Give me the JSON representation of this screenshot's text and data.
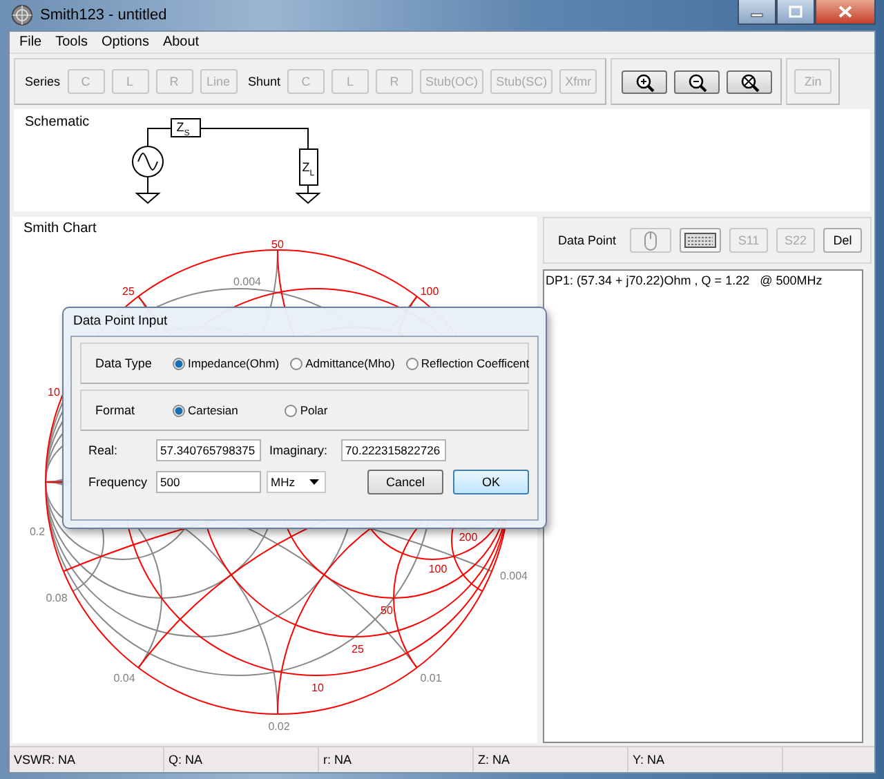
{
  "window": {
    "title": "Smith123 - untitled"
  },
  "menu": [
    "File",
    "Tools",
    "Options",
    "About"
  ],
  "toolbar": {
    "series_label": "Series",
    "series_buttons": [
      {
        "label": "C",
        "disabled": true
      },
      {
        "label": "L",
        "disabled": true
      },
      {
        "label": "R",
        "disabled": true
      },
      {
        "label": "Line",
        "disabled": true
      }
    ],
    "shunt_label": "Shunt",
    "shunt_buttons": [
      {
        "label": "C",
        "disabled": true
      },
      {
        "label": "L",
        "disabled": true
      },
      {
        "label": "R",
        "disabled": true
      },
      {
        "label": "Stub(OC)",
        "disabled": true
      },
      {
        "label": "Stub(SC)",
        "disabled": true
      },
      {
        "label": "Xfmr",
        "disabled": true
      }
    ],
    "zoom_buttons": [
      {
        "kind": "zoom-in",
        "disabled": false
      },
      {
        "kind": "zoom-out",
        "disabled": false
      },
      {
        "kind": "zoom-fit",
        "disabled": false
      }
    ],
    "zin_button": {
      "label": "Zin",
      "disabled": true
    }
  },
  "schematic": {
    "title": "Schematic",
    "source_label": "Z$_{S}$",
    "load_label": "Z$_{L}$"
  },
  "smith_chart": {
    "title": "Smith Chart",
    "labels": [
      {
        "text": "50",
        "kind": "impedance"
      },
      {
        "text": "0.004",
        "kind": "admittance"
      },
      {
        "text": "25",
        "kind": "impedance"
      },
      {
        "text": "100",
        "kind": "impedance"
      },
      {
        "text": "10",
        "kind": "impedance"
      },
      {
        "text": "0.2",
        "kind": "admittance"
      },
      {
        "text": "0.08",
        "kind": "admittance"
      },
      {
        "text": "200",
        "kind": "impedance"
      },
      {
        "text": "100",
        "kind": "impedance"
      },
      {
        "text": "0.004",
        "kind": "admittance"
      },
      {
        "text": "50",
        "kind": "impedance"
      },
      {
        "text": "25",
        "kind": "impedance"
      },
      {
        "text": "0.04",
        "kind": "admittance"
      },
      {
        "text": "0.01",
        "kind": "admittance"
      },
      {
        "text": "10",
        "kind": "impedance"
      },
      {
        "text": "0.02",
        "kind": "admittance"
      }
    ]
  },
  "data_point": {
    "label": "Data Point",
    "buttons": [
      {
        "kind": "mouse",
        "disabled": true
      },
      {
        "kind": "keyboard",
        "disabled": false
      },
      {
        "kind": "text",
        "label": "S11",
        "disabled": true
      },
      {
        "kind": "text",
        "label": "S22",
        "disabled": true
      },
      {
        "kind": "text",
        "label": "Del",
        "disabled": false
      }
    ],
    "log": [
      "DP1: (57.34 + j70.22)Ohm , Q = 1.22   @ 500MHz"
    ]
  },
  "dialog": {
    "title": "Data Point Input",
    "data_type": {
      "label": "Data Type",
      "options": [
        {
          "label": "Impedance(Ohm)",
          "selected": true
        },
        {
          "label": "Admittance(Mho)",
          "selected": false
        },
        {
          "label": "Reflection Coefficent",
          "selected": false
        }
      ]
    },
    "format": {
      "label": "Format",
      "options": [
        {
          "label": "Cartesian",
          "selected": true
        },
        {
          "label": "Polar",
          "selected": false
        }
      ]
    },
    "real": {
      "label": "Real:",
      "value": "57.340765798375"
    },
    "imaginary": {
      "label": "Imaginary:",
      "value": "70.222315822726"
    },
    "frequency": {
      "label": "Frequency",
      "value": "500",
      "unit": "MHz"
    },
    "buttons": [
      {
        "label": "Cancel",
        "default": false
      },
      {
        "label": "OK",
        "default": true
      }
    ]
  },
  "status_bar": [
    "VSWR: NA",
    "Q: NA",
    "r: NA",
    "Z: NA",
    "Y: NA"
  ]
}
